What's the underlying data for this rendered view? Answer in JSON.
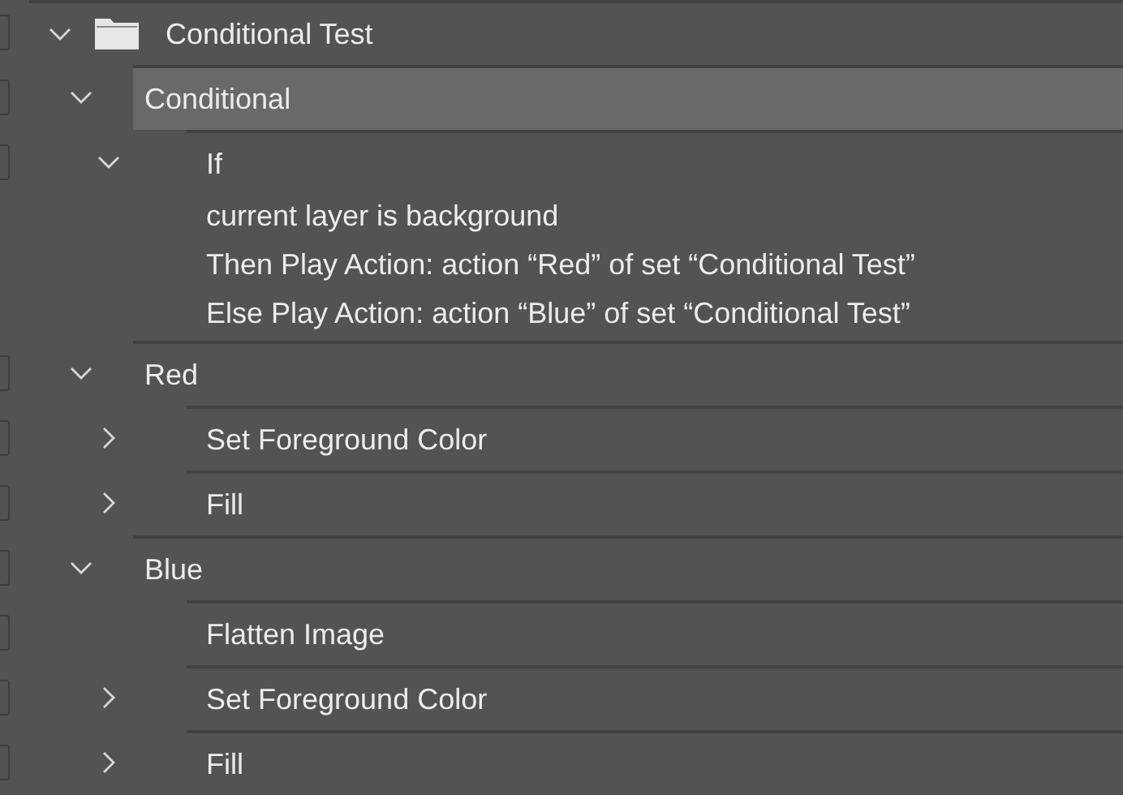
{
  "action_set": {
    "name": "Conditional Test",
    "expanded": true,
    "actions": [
      {
        "name": "Conditional",
        "expanded": true,
        "selected": true,
        "steps": [
          {
            "kind": "expandable",
            "name": "If",
            "expanded": true,
            "details": [
              "current layer is background",
              "Then Play Action: action “Red” of set “Conditional Test”",
              "Else Play Action: action “Blue” of set “Conditional Test”"
            ]
          }
        ]
      },
      {
        "name": "Red",
        "expanded": true,
        "selected": false,
        "steps": [
          {
            "kind": "expandable",
            "name": "Set Foreground Color",
            "expanded": false
          },
          {
            "kind": "expandable",
            "name": "Fill",
            "expanded": false
          }
        ]
      },
      {
        "name": "Blue",
        "expanded": true,
        "selected": false,
        "steps": [
          {
            "kind": "plain",
            "name": "Flatten Image"
          },
          {
            "kind": "expandable",
            "name": "Set Foreground Color",
            "expanded": false
          },
          {
            "kind": "expandable",
            "name": "Fill",
            "expanded": false
          }
        ]
      }
    ]
  }
}
